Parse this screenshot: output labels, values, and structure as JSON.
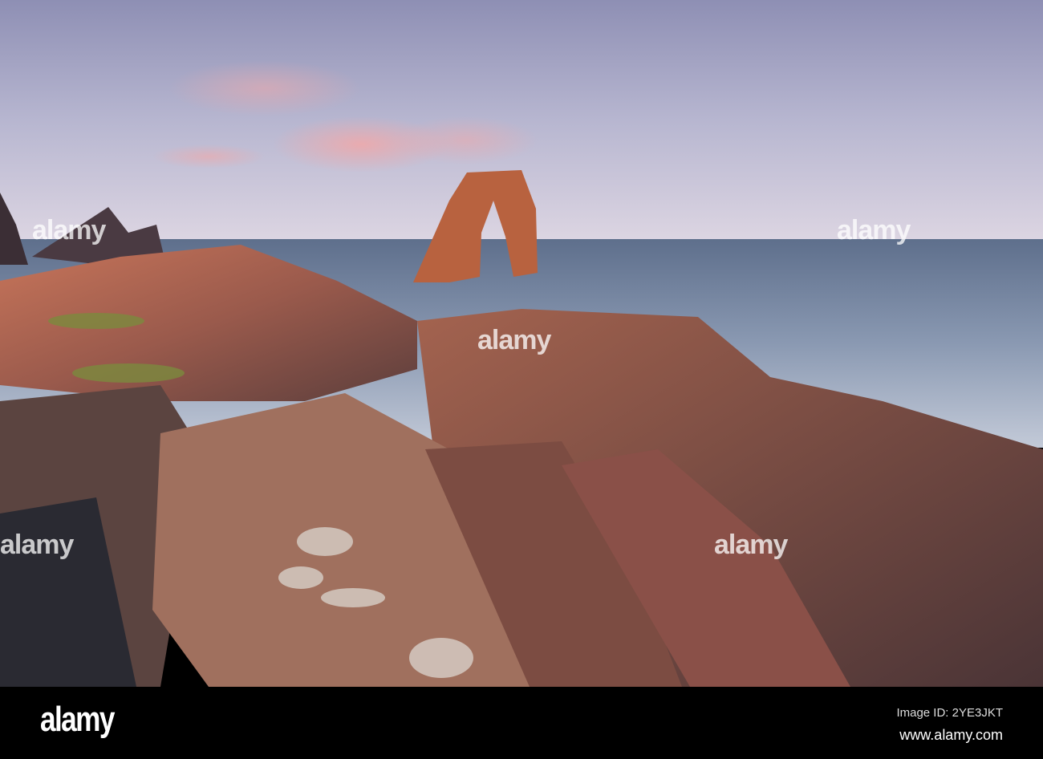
{
  "watermark": "alamy",
  "footer": {
    "logo": "alamy",
    "image_id": "Image ID: 2YE3JKT",
    "website": "www.alamy.com"
  }
}
